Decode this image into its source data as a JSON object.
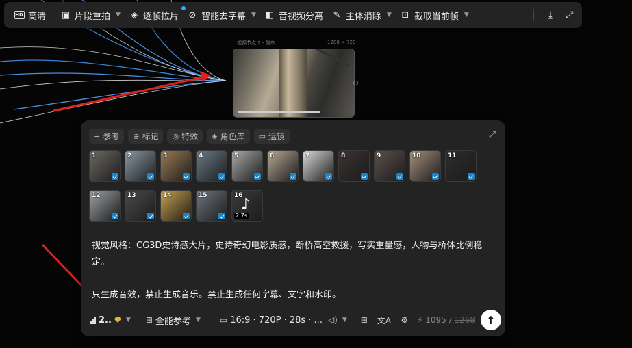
{
  "toolbar": {
    "items": [
      {
        "label": "高清",
        "icon": "hd-icon"
      },
      {
        "label": "片段重拍",
        "icon": "video-icon"
      },
      {
        "label": "逐帧拉片",
        "icon": "frames-icon"
      },
      {
        "label": "智能去字幕",
        "icon": "subtitle-off-icon"
      },
      {
        "label": "音视频分离",
        "icon": "audio-split-icon"
      },
      {
        "label": "主体消除",
        "icon": "edit-icon"
      },
      {
        "label": "截取当前帧",
        "icon": "capture-icon"
      }
    ],
    "download_icon": "download-icon",
    "fullscreen_icon": "fullscreen-icon"
  },
  "node": {
    "title": "视频节点 2 - 副本",
    "size": "1280 × 720"
  },
  "chips": [
    {
      "label": "参考",
      "icon": "+"
    },
    {
      "label": "标记",
      "icon": "⊕"
    },
    {
      "label": "特效",
      "icon": "◎"
    },
    {
      "label": "角色库",
      "icon": "◈"
    },
    {
      "label": "运镜",
      "icon": "▭"
    }
  ],
  "thumbnails": [
    {
      "num": "1",
      "color": "#6d6a63"
    },
    {
      "num": "2",
      "color": "#8a99a4"
    },
    {
      "num": "3",
      "color": "#9a7c52"
    },
    {
      "num": "4",
      "color": "#687b86"
    },
    {
      "num": "5",
      "color": "#a8a8a8"
    },
    {
      "num": "6",
      "color": "#b7a793"
    },
    {
      "num": "7",
      "color": "#d8d8d8"
    },
    {
      "num": "8",
      "color": "#3a3230"
    },
    {
      "num": "9",
      "color": "#5c5049"
    },
    {
      "num": "10",
      "color": "#a48f7c"
    },
    {
      "num": "11",
      "color": "#2c2c2c"
    },
    {
      "num": "12",
      "color": "#9ea3a6"
    },
    {
      "num": "13",
      "color": "#4a4a4a"
    },
    {
      "num": "14",
      "color": "#c9a14a"
    },
    {
      "num": "15",
      "color": "#6e7680"
    },
    {
      "num": "16",
      "color": "#3a3a3a",
      "duration": "2.7s",
      "audio": true
    }
  ],
  "prompt": {
    "line1": "视觉风格：CG3D史诗感大片，史诗奇幻电影质感，断桥高空救援，写实重量感，人物与桥体比例稳定。",
    "line2": "只生成音效，禁止生成音乐。禁止生成任何字幕、文字和水印。"
  },
  "bottom": {
    "model": "2..",
    "mode": "全能参考",
    "settings": "16:9 · 720P · 28s · ...",
    "count": "1095",
    "max": "1268"
  }
}
